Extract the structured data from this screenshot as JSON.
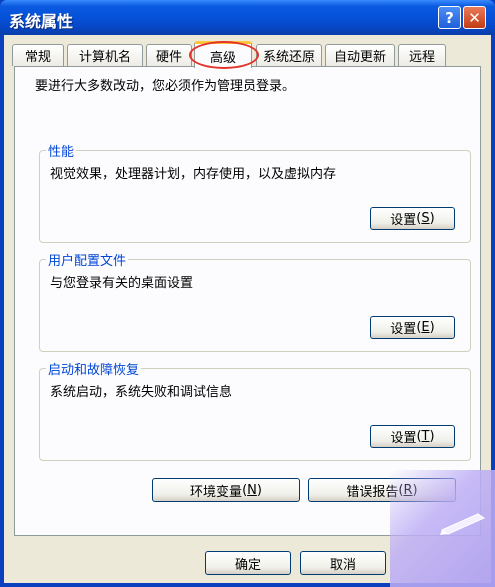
{
  "window": {
    "title": "系统属性",
    "help_glyph": "?",
    "close_glyph": "✕"
  },
  "tabs": [
    {
      "label": "常规"
    },
    {
      "label": "计算机名"
    },
    {
      "label": "硬件"
    },
    {
      "label": "高级"
    },
    {
      "label": "系统还原"
    },
    {
      "label": "自动更新"
    },
    {
      "label": "远程"
    }
  ],
  "active_tab": "高级",
  "admin_note": "要进行大多数改动，您必须作为管理员登录。",
  "performance": {
    "title": "性能",
    "desc": "视觉效果，处理器计划，内存使用，以及虚拟内存",
    "button": {
      "label": "设置",
      "hotkey": "S"
    }
  },
  "user_profiles": {
    "title": "用户配置文件",
    "desc": "与您登录有关的桌面设置",
    "button": {
      "label": "设置",
      "hotkey": "E"
    }
  },
  "startup_recovery": {
    "title": "启动和故障恢复",
    "desc": "系统启动，系统失败和调试信息",
    "button": {
      "label": "设置",
      "hotkey": "T"
    }
  },
  "env_vars_button": {
    "label": "环境变量",
    "hotkey": "N"
  },
  "error_report_button": {
    "label": "错误报告",
    "hotkey": "R"
  },
  "ok_button": {
    "label": "确定"
  },
  "cancel_button": {
    "label": "取消"
  },
  "colors": {
    "titlebar": "#0551d8",
    "group_title": "#0046d5",
    "highlight_circle": "#e2342c",
    "active_tab_top": "#ffc83c"
  }
}
